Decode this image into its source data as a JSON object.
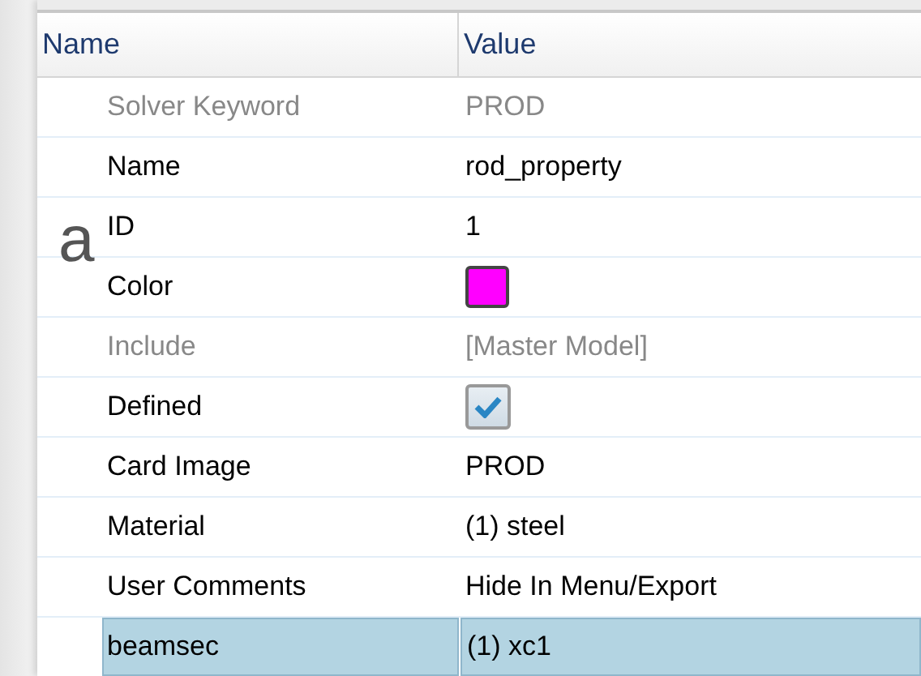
{
  "background_text": "a",
  "table": {
    "columns": [
      "Name",
      "Value"
    ],
    "rows": [
      {
        "name": "Solver Keyword",
        "kind": "text",
        "value": "PROD",
        "disabled": true,
        "selected": false
      },
      {
        "name": "Name",
        "kind": "text",
        "value": "rod_property",
        "disabled": false,
        "selected": false
      },
      {
        "name": "ID",
        "kind": "text",
        "value": "1",
        "disabled": false,
        "selected": false
      },
      {
        "name": "Color",
        "kind": "color",
        "color": "#ff00ff",
        "disabled": false,
        "selected": false
      },
      {
        "name": "Include",
        "kind": "text",
        "value": "[Master Model]",
        "disabled": true,
        "selected": false
      },
      {
        "name": "Defined",
        "kind": "checkbox",
        "checked": true,
        "disabled": false,
        "selected": false
      },
      {
        "name": "Card Image",
        "kind": "text",
        "value": "PROD",
        "disabled": false,
        "selected": false
      },
      {
        "name": "Material",
        "kind": "text",
        "value": "(1) steel",
        "disabled": false,
        "selected": false
      },
      {
        "name": "User Comments",
        "kind": "text",
        "value": "Hide In Menu/Export",
        "disabled": false,
        "selected": false
      },
      {
        "name": "beamsec",
        "kind": "text",
        "value": "(1) xc1",
        "disabled": false,
        "selected": true
      }
    ]
  }
}
